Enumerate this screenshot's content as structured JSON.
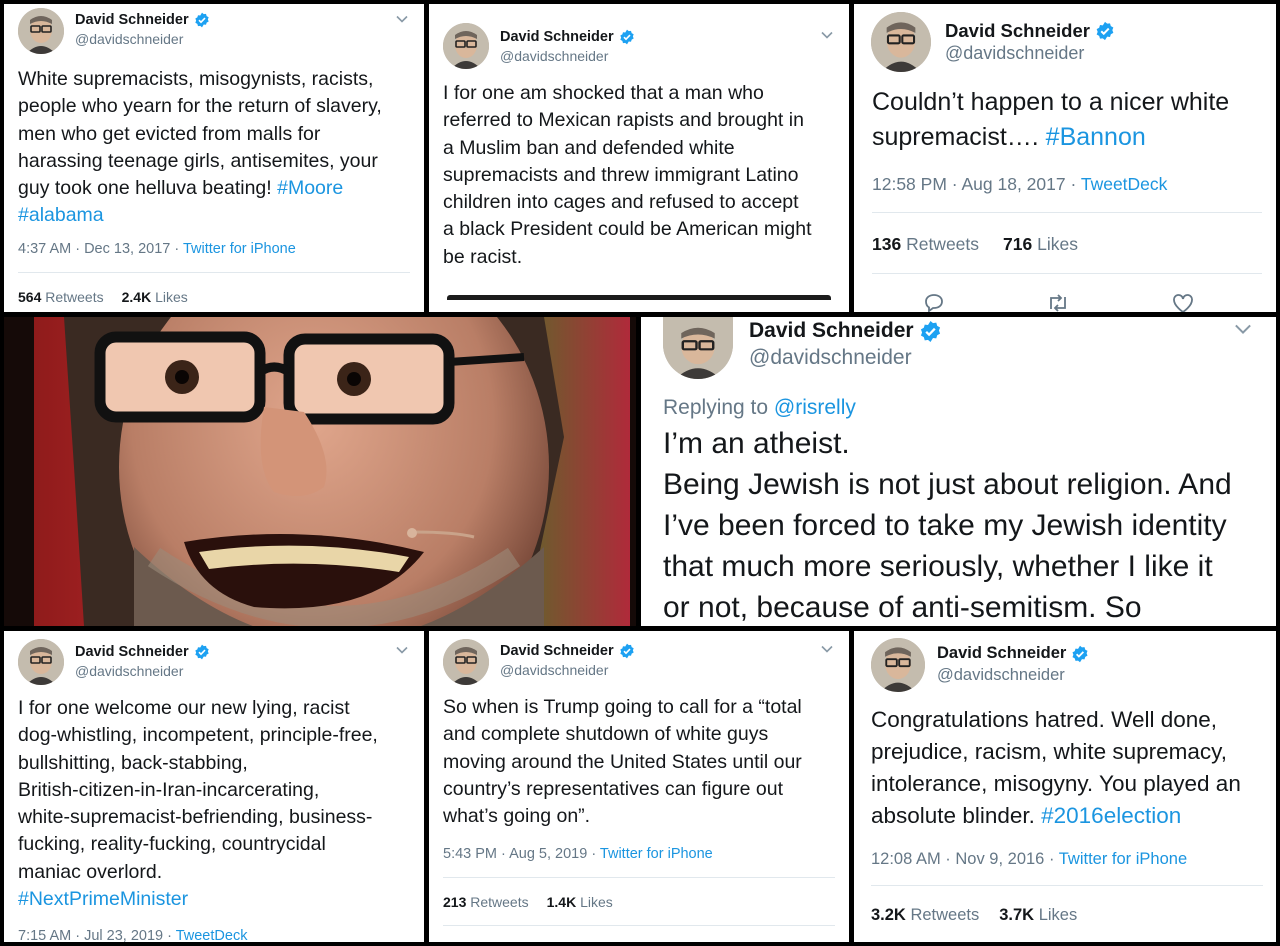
{
  "profile": {
    "name": "David Schneider",
    "handle": "@davidschneider"
  },
  "tweets": {
    "t1": {
      "text": "White supremacists, misogynists, racists,\npeople who yearn for the return of slavery,\nmen who get evicted from malls for\nharassing teenage girls, antisemites, your\nguy took one helluva beating! ",
      "tags": "#Moore\n#alabama",
      "time": "4:37 AM · Dec 13, 2017 · ",
      "source": "Twitter for iPhone",
      "retweets": "564",
      "retweets_label": "Retweets",
      "likes": "2.4K",
      "likes_label": "Likes"
    },
    "t2": {
      "text": "I for one am shocked that a man who\nreferred to Mexican rapists and brought in\na Muslim ban and defended white\nsupremacists and threw immigrant Latino\nchildren into cages and refused to accept\na black President could be American might\nbe racist."
    },
    "t3": {
      "text": "Couldn’t happen to a nicer white\nsupremacist…. ",
      "tag": "#Bannon",
      "time": "12:58 PM · Aug 18, 2017 · ",
      "source": "TweetDeck",
      "retweets": "136",
      "retweets_label": "Retweets",
      "likes": "716",
      "likes_label": "Likes"
    },
    "t4": {
      "replying_label": "Replying to ",
      "replying_to": "@risrelly",
      "text": "I’m an atheist.\nBeing Jewish is not just about religion. And\nI’ve been forced to take my Jewish identity\nthat much more seriously, whether I like it\nor not, because of anti-semitism. So"
    },
    "t5": {
      "text": "I for one welcome our new lying, racist\ndog-whistling, incompetent, principle-free,\nbullshitting, back-stabbing,\nBritish-citizen-in-Iran-incarcerating,\nwhite-supremacist-befriending, business-\nfucking, reality-fucking, countrycidal\nmaniac overlord.",
      "tag": "#NextPrimeMinister",
      "time": "7:15 AM · Jul 23, 2019 · ",
      "source": "TweetDeck"
    },
    "t6": {
      "text": "So when is Trump going to call for a “total\nand complete shutdown of white guys\nmoving around the United States until our\ncountry’s representatives can figure out\nwhat’s going on”.",
      "time": "5:43 PM · Aug 5, 2019 · ",
      "source": "Twitter for iPhone",
      "retweets": "213",
      "retweets_label": "Retweets",
      "likes": "1.4K",
      "likes_label": "Likes"
    },
    "t7": {
      "text": "Congratulations hatred. Well done,\nprejudice, racism, white supremacy,\nintolerance, misogyny. You played an\nabsolute blinder. ",
      "tag": "#2016election",
      "time": "12:08 AM · Nov 9, 2016 · ",
      "source": "Twitter for iPhone",
      "retweets": "3.2K",
      "retweets_label": "Retweets",
      "likes": "3.7K",
      "likes_label": "Likes"
    }
  },
  "icons": {
    "verified": "verified-badge-icon",
    "chevron": "chevron-down-icon",
    "reply": "reply-icon",
    "retweet": "retweet-icon",
    "like": "like-icon"
  },
  "colors": {
    "link": "#1b95e0",
    "muted": "#657786",
    "text": "#14171a",
    "verified": "#1da1f2"
  }
}
